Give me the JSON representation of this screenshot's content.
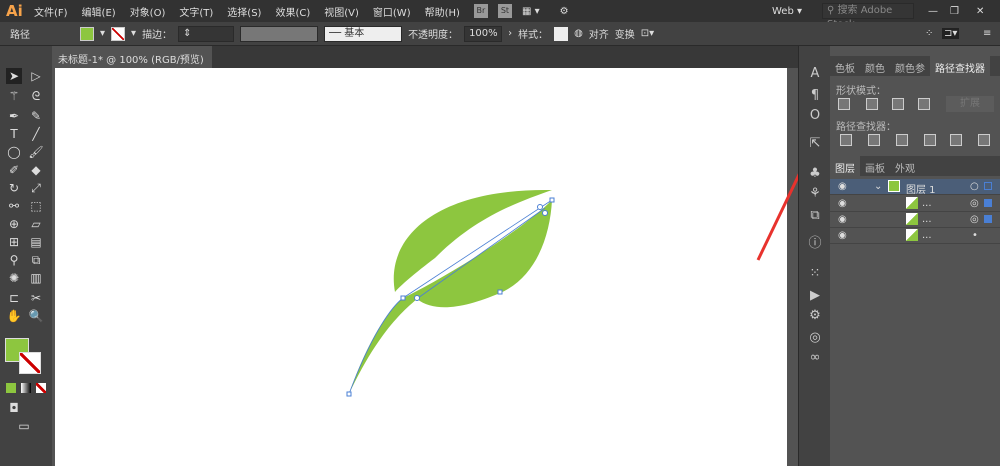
{
  "app": {
    "logo": "Ai"
  },
  "menu": [
    "文件(F)",
    "编辑(E)",
    "对象(O)",
    "文字(T)",
    "选择(S)",
    "效果(C)",
    "视图(V)",
    "窗口(W)",
    "帮助(H)"
  ],
  "menubar_right": {
    "br": "Br",
    "st": "St",
    "workspace": "Web",
    "search_placeholder": "搜索 Adobe Stock"
  },
  "control": {
    "selection": "路径",
    "fill_color": "#8dc63f",
    "stroke_label": "描边：",
    "stroke_style": "基本",
    "opacity_label": "不透明度：",
    "opacity": "100%",
    "style_label": "样式：",
    "align": "对齐",
    "transform": "变换"
  },
  "document": {
    "tab": "未标题-1* @ 100% (RGB/预览)"
  },
  "pathfinder": {
    "tabs": [
      "色板",
      "颜色",
      "颜色参",
      "路径查找器"
    ],
    "shape_modes": "形状模式：",
    "expand": "扩展",
    "pathfinders": "路径查找器："
  },
  "layers": {
    "tabs": [
      "图层",
      "画板",
      "外观"
    ],
    "layer": "图层 1",
    "items": [
      "...",
      "...",
      "..."
    ]
  },
  "colors": {
    "leaf": "#8dc63f",
    "selection": "#4a7fd4",
    "arrow": "#e8322d"
  }
}
